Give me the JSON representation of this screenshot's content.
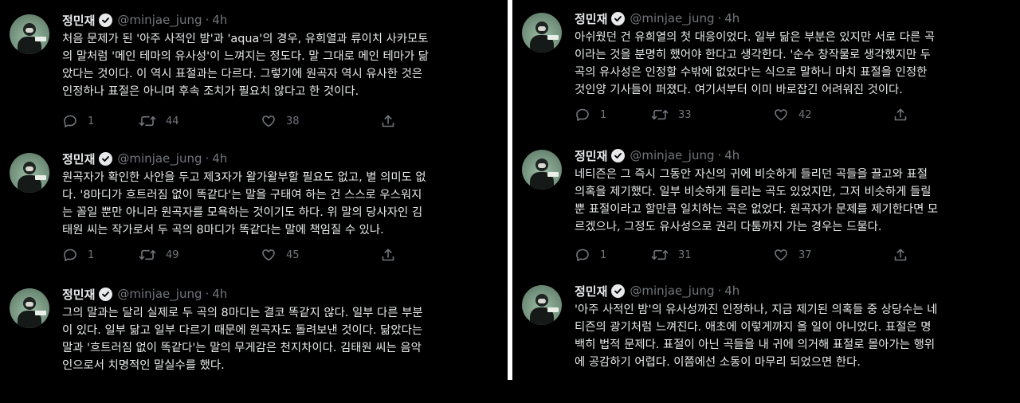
{
  "left_column": [
    {
      "author": {
        "name": "정민재",
        "handle": "@minjae_jung",
        "separator": "·",
        "time": "4h"
      },
      "lines": [
        "처음 문제가 된 '아주 사적인 밤'과 'aqua'의 경우, 유희열과 류이치 사카모토",
        "의 말처럼 '메인 테마의 유사성'이 느껴지는 정도다. 말 그대로 메인 테마가 닮",
        "았다는 것이다. 이 역시 표절과는 다르다. 그렇기에 원곡자 역시 유사한 것은",
        "인정하나 표절은 아니며 후속 조치가 필요치 않다고 한 것이다."
      ],
      "replies": "1",
      "retweets": "44",
      "likes": "38"
    },
    {
      "author": {
        "name": "정민재",
        "handle": "@minjae_jung",
        "separator": "·",
        "time": "4h"
      },
      "lines": [
        "원곡자가 확인한 사안을 두고 제3자가 왈가왈부할 필요도 없고, 별 의미도 없",
        "다. '8마디가 흐트러짐 없이 똑같다'는 말을 구태여 하는 건 스스로 우스워지",
        "는 꼴일 뿐만 아니라 원곡자를 모욕하는 것이기도 하다. 위 말의 당사자인 김",
        "태원 씨는 작가로서 두 곡의 8마디가 똑같다는 말에 책임질 수 있나."
      ],
      "replies": "1",
      "retweets": "49",
      "likes": "45"
    },
    {
      "author": {
        "name": "정민재",
        "handle": "@minjae_jung",
        "separator": "·",
        "time": "4h"
      },
      "lines": [
        "그의 말과는 달리 실제로 두 곡의 8마디는 결코 똑같지 않다. 일부 다른 부분",
        "이 있다. 일부 닮고 일부 다르기 때문에 원곡자도 돌려보낸 것이다. 닮았다는",
        "말과 '흐트러짐 없이 똑같다'는 말의 무게감은 천지차이다. 김태원 씨는 음악",
        "인으로서 치명적인 말실수를 했다."
      ],
      "replies": "",
      "retweets": "",
      "likes": ""
    }
  ],
  "right_column": [
    {
      "author": {
        "name": "정민재",
        "handle": "@minjae_jung",
        "separator": "·",
        "time": "4h"
      },
      "lines": [
        "아쉬웠던 건 유희열의 첫 대응이었다. 일부 닮은 부분은 있지만 서로 다른 곡",
        "이라는 것을 분명히 했어야 한다고 생각한다. '순수 창작물로 생각했지만 두",
        "곡의 유사성은 인정할 수밖에 없었다'는 식으로 말하니 마치 표절을 인정한",
        "것인양 기사들이 퍼졌다. 여기서부터 이미 바로잡긴 어려워진 것이다."
      ],
      "replies": "1",
      "retweets": "33",
      "likes": "42"
    },
    {
      "author": {
        "name": "정민재",
        "handle": "@minjae_jung",
        "separator": "·",
        "time": "4h"
      },
      "lines": [
        "네티즌은 그 즉시 그동안 자신의 귀에 비슷하게 들리던 곡들을 끌고와 표절",
        "의혹을 제기했다. 일부 비슷하게 들리는 곡도 있었지만, 그저 비슷하게 들릴",
        "뿐 표절이라고 할만큼 일치하는 곡은 없었다. 원곡자가 문제를 제기한다면 모",
        "르겠으나, 그정도 유사성으로 권리 다툼까지 가는 경우는 드물다."
      ],
      "replies": "1",
      "retweets": "31",
      "likes": "37"
    },
    {
      "author": {
        "name": "정민재",
        "handle": "@minjae_jung",
        "separator": "·",
        "time": "4h"
      },
      "lines": [
        "'아주 사적인 밤'의 유사성까진 인정하나, 지금 제기된 의혹들 중 상당수는 네",
        "티즌의 광기처럼 느껴진다. 애초에 이렇게까지 올 일이 아니었다. 표절은 명",
        "백히 법적 문제다. 표절이 아닌 곡들을 내 귀에 의거해 표절로 몰아가는 행위",
        "에 공감하기 어렵다. 이쯤에선 소동이 마무리 되었으면 한다."
      ],
      "replies": "",
      "retweets": "",
      "likes": ""
    }
  ],
  "icons": {
    "verified": "verified-badge-icon",
    "reply": "reply-icon",
    "retweet": "retweet-icon",
    "like": "like-icon",
    "share": "share-icon"
  },
  "colors": {
    "background": "#000000",
    "text": "#e7e9ea",
    "secondary": "#71767b"
  }
}
